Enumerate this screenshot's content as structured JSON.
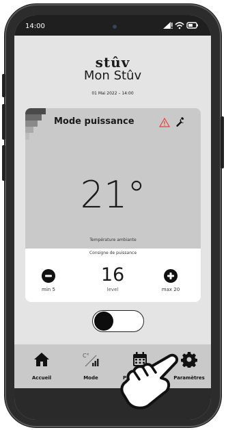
{
  "status": {
    "time": "14:00"
  },
  "header": {
    "brand": "stûv",
    "subtitle": "Mon Stûv",
    "datetime": "01 Mai 2022  –  14:00"
  },
  "card": {
    "mode_title": "Mode puissance",
    "temperature": "21°",
    "temperature_label": "Température ambiante",
    "consigne_label": "Consigne de puissance",
    "level_value": "16",
    "level_label": "level",
    "min_label": "min 5",
    "max_label": "max 20"
  },
  "toggle": {
    "state": "off"
  },
  "nav": {
    "items": [
      {
        "label": "Accueil",
        "icon": "home-icon"
      },
      {
        "label": "Mode",
        "icon": "mode-icon"
      },
      {
        "label": "Programmes",
        "icon": "calendar-icon"
      },
      {
        "label": "Paramètres",
        "icon": "gear-icon"
      }
    ]
  },
  "colors": {
    "warning": "#e0443a",
    "screen_bg": "#e4e4e4",
    "card_bg": "#c9c9c9"
  }
}
